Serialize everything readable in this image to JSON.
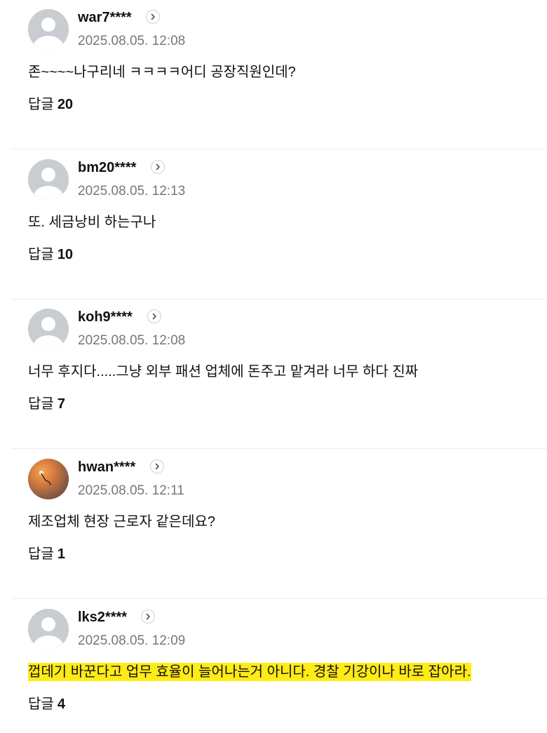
{
  "comments": [
    {
      "username": "war7****",
      "timestamp": "2025.08.05. 12:08",
      "text": "존~~~~나구리네 ㅋㅋㅋㅋ어디 공장직원인데?",
      "reply_label": "답글",
      "reply_count": "20",
      "avatar": "default-profile-icon",
      "highlighted": false
    },
    {
      "username": "bm20****",
      "timestamp": "2025.08.05. 12:13",
      "text": "또. 세금낭비 하는구나",
      "reply_label": "답글",
      "reply_count": "10",
      "avatar": "default-profile-icon",
      "highlighted": false
    },
    {
      "username": "koh9****",
      "timestamp": "2025.08.05. 12:08",
      "text": "너무 후지다.....그냥 외부 패션 업체에 돈주고 맡겨라 너무 하다 진짜",
      "reply_label": "답글",
      "reply_count": "7",
      "avatar": "default-profile-icon",
      "highlighted": false
    },
    {
      "username": "hwan****",
      "timestamp": "2025.08.05. 12:11",
      "text": "제조업체 현장 근로자 같은데요?",
      "reply_label": "답글",
      "reply_count": "1",
      "avatar": "sunset-photo",
      "highlighted": false
    },
    {
      "username": "lks2****",
      "timestamp": "2025.08.05. 12:09",
      "text": "껍데기 바꾼다고 업무 효율이 늘어나는거 아니다. 경찰 기강이나 바로 잡아라.",
      "reply_label": "답글",
      "reply_count": "4",
      "avatar": "default-profile-icon",
      "highlighted": true
    }
  ],
  "colors": {
    "highlight": "#ffeb16",
    "timestamp": "#777777",
    "divider": "#eeeeee",
    "avatar_bg": "#c9ccd1"
  }
}
